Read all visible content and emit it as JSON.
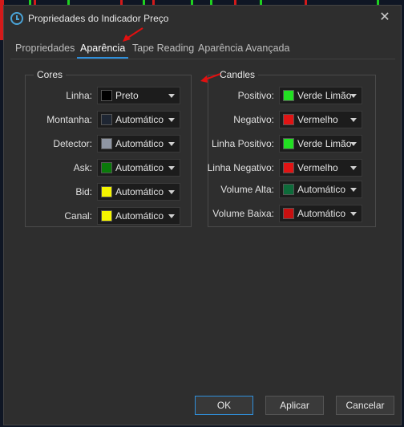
{
  "window": {
    "title": "Propriedades do Indicador Preço"
  },
  "tabs": [
    {
      "label": "Propriedades"
    },
    {
      "label": "Aparência"
    },
    {
      "label": "Tape Reading"
    },
    {
      "label": "Aparência Avançada"
    }
  ],
  "cores": {
    "label": "Cores",
    "rows": [
      {
        "label": "Linha:",
        "color": "#000000",
        "value": "Preto"
      },
      {
        "label": "Montanha:",
        "color": "#1e2633",
        "value": "Automático"
      },
      {
        "label": "Detector:",
        "color": "#8f96a3",
        "value": "Automático"
      },
      {
        "label": "Ask:",
        "color": "#0a7a0a",
        "value": "Automático"
      },
      {
        "label": "Bid:",
        "color": "#f5f500",
        "value": "Automático"
      },
      {
        "label": "Canal:",
        "color": "#f5f500",
        "value": "Automático"
      }
    ]
  },
  "candles": {
    "label": "Candles",
    "rows": [
      {
        "label": "Positivo:",
        "color": "#22e022",
        "value": "Verde Limão"
      },
      {
        "label": "Negativo:",
        "color": "#e01414",
        "value": "Vermelho"
      },
      {
        "label": "Linha Positivo:",
        "color": "#22e022",
        "value": "Verde Limão"
      },
      {
        "label": "Linha Negativo:",
        "color": "#e01414",
        "value": "Vermelho"
      },
      {
        "label": "Volume Alta:",
        "color": "#0d6b3a",
        "value": "Automático"
      },
      {
        "label": "Volume Baixa:",
        "color": "#c81010",
        "value": "Automático"
      }
    ]
  },
  "buttons": {
    "ok": "OK",
    "apply": "Aplicar",
    "cancel": "Cancelar"
  },
  "colors": {
    "accent": "#2f8fdb",
    "annotation": "#e01010"
  }
}
